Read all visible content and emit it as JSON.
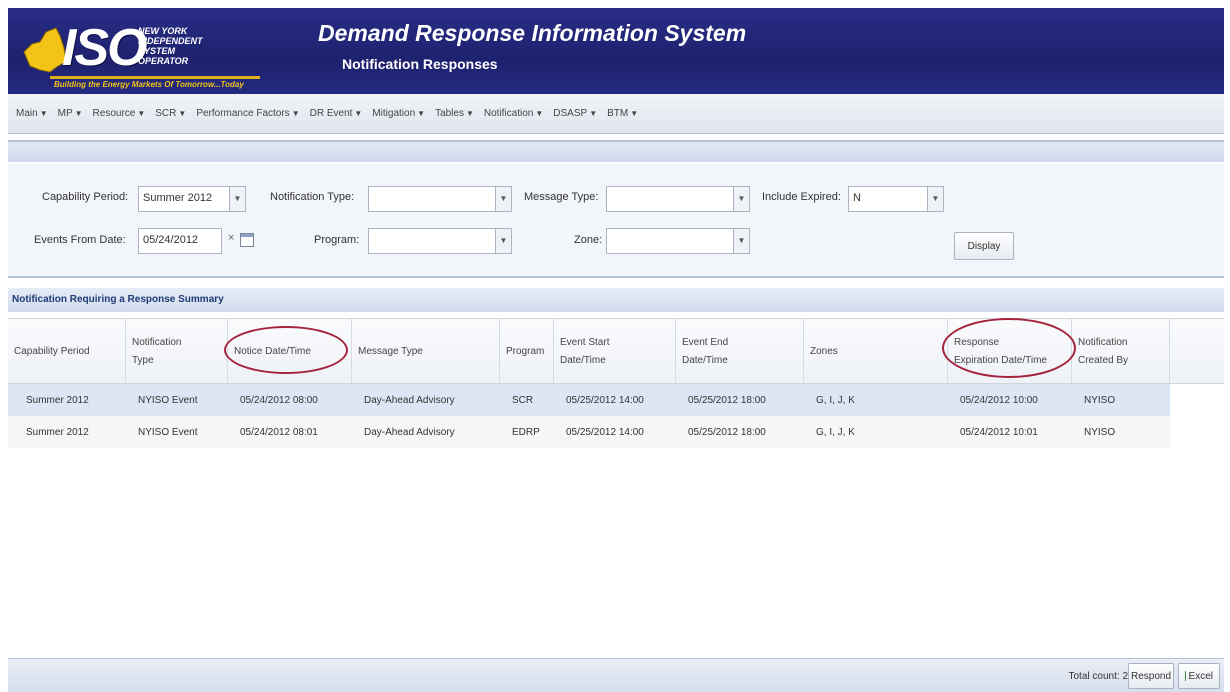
{
  "header": {
    "logo_text": "ISO",
    "org_lines": [
      "NEW YORK",
      "INDEPENDENT",
      "SYSTEM OPERATOR"
    ],
    "tagline": "Building the Energy Markets Of Tomorrow...Today",
    "app_title": "Demand Response Information System",
    "page_subtitle": "Notification Responses"
  },
  "menu": [
    "Main",
    "MP",
    "Resource",
    "SCR",
    "Performance Factors",
    "DR Event",
    "Mitigation",
    "Tables",
    "Notification",
    "DSASP",
    "BTM"
  ],
  "filters": {
    "capability_period": {
      "label": "Capability Period:",
      "value": "Summer 2012"
    },
    "notification_type": {
      "label": "Notification Type:",
      "value": ""
    },
    "message_type": {
      "label": "Message Type:",
      "value": ""
    },
    "include_expired": {
      "label": "Include Expired:",
      "value": "N"
    },
    "events_from_date": {
      "label": "Events From Date:",
      "value": "05/24/2012",
      "clear": "×"
    },
    "program": {
      "label": "Program:",
      "value": ""
    },
    "zone": {
      "label": "Zone:",
      "value": ""
    },
    "display_button": "Display"
  },
  "grid": {
    "title": "Notification Requiring a Response Summary",
    "columns": [
      [
        "Capability Period"
      ],
      [
        "Notification",
        "Type"
      ],
      [
        "Notice Date/Time"
      ],
      [
        "Message Type"
      ],
      [
        "Program"
      ],
      [
        "Event Start",
        "Date/Time"
      ],
      [
        "Event End",
        "Date/Time"
      ],
      [
        "Zones"
      ],
      [
        "Response",
        "Expiration Date/Time"
      ],
      [
        "Notification",
        "Created By"
      ]
    ],
    "rows": [
      [
        "Summer 2012",
        "NYISO Event",
        "05/24/2012 08:00",
        "Day-Ahead Advisory",
        "SCR",
        "05/25/2012 14:00",
        "05/25/2012 18:00",
        "G, I, J, K",
        "05/24/2012 10:00",
        "NYISO"
      ],
      [
        "Summer 2012",
        "NYISO Event",
        "05/24/2012 08:01",
        "Day-Ahead Advisory",
        "EDRP",
        "05/25/2012 14:00",
        "05/25/2012 18:00",
        "G, I, J, K",
        "05/24/2012 10:01",
        "NYISO"
      ]
    ]
  },
  "footer": {
    "total_label": "Total count:",
    "total_count": "2",
    "respond_button": "Respond",
    "excel_button": "Excel"
  },
  "colors": {
    "header_bg": "#1d216e",
    "highlight_circle": "#a3243c",
    "selected_row": "#dde6f4"
  }
}
